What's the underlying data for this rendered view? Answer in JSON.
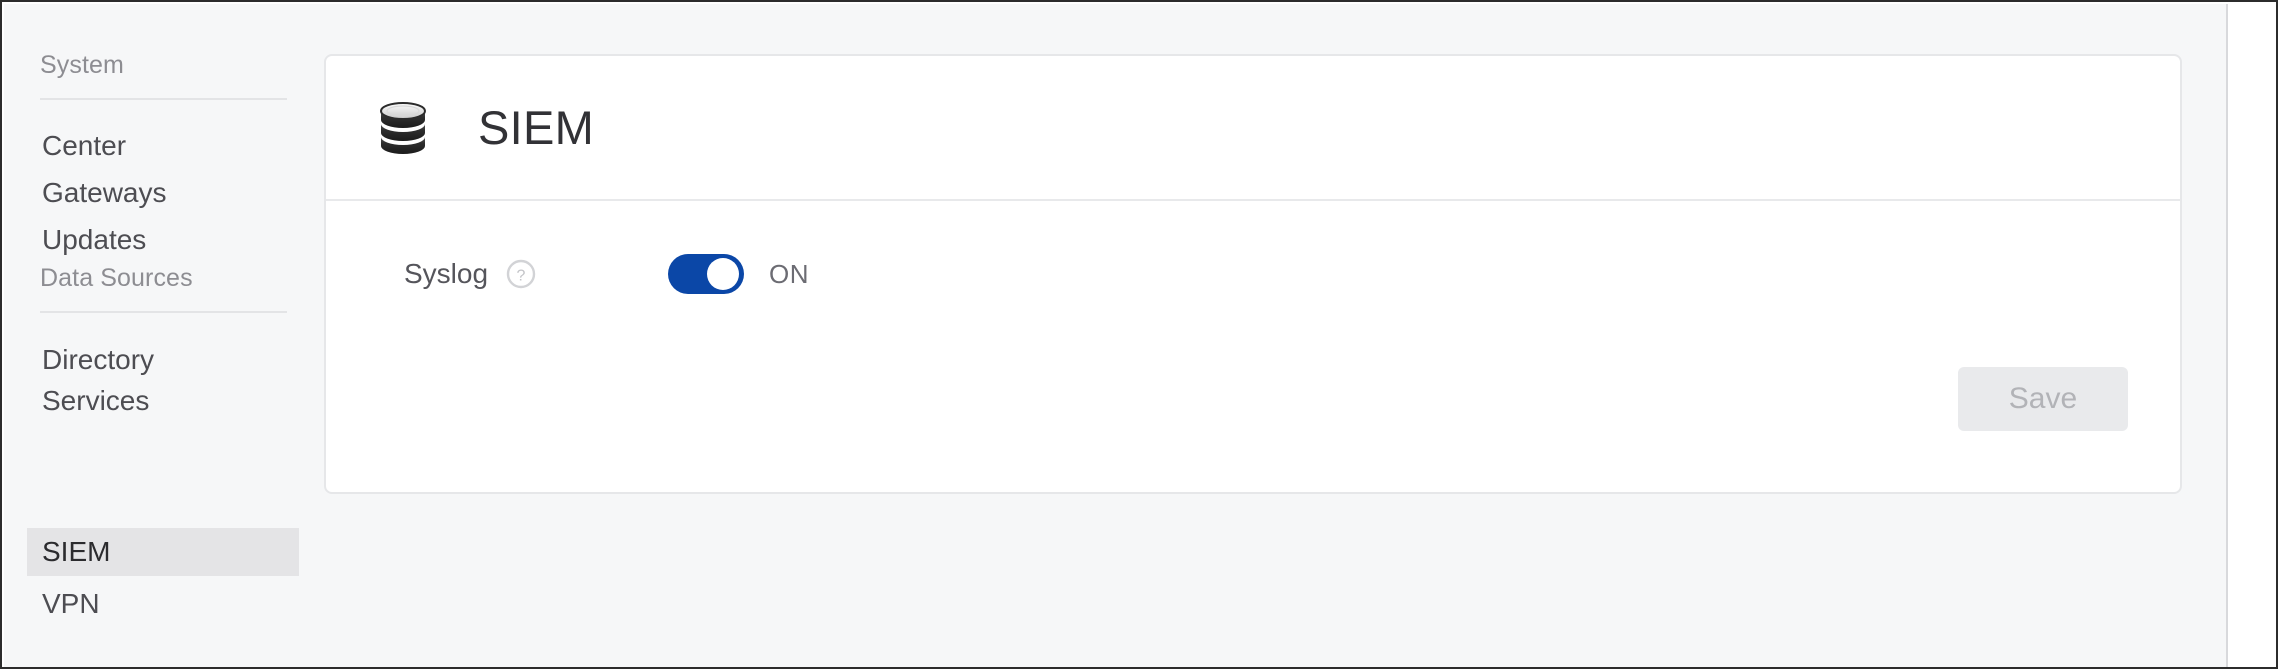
{
  "sidebar": {
    "sections": [
      {
        "title": "System",
        "items": [
          {
            "label": "Center",
            "active": false
          },
          {
            "label": "Gateways",
            "active": false
          },
          {
            "label": "Updates",
            "active": false
          }
        ]
      },
      {
        "title": "Data Sources",
        "items": [
          {
            "label": "Directory Services",
            "active": false
          },
          {
            "label": "SIEM",
            "active": true
          },
          {
            "label": "VPN",
            "active": false
          }
        ]
      }
    ]
  },
  "card": {
    "icon": "database-icon",
    "title": "SIEM",
    "settings": [
      {
        "label": "Syslog",
        "help_icon": "help-circle-icon",
        "toggle_on": true,
        "state_label": "ON"
      }
    ],
    "save_label": "Save",
    "save_disabled": true
  },
  "colors": {
    "accent": "#0b47a7",
    "page_background": "#f6f7f8",
    "card_background": "#ffffff",
    "active_nav_background": "#e4e4e6",
    "disabled_button_background": "#e9eaec",
    "disabled_button_text": "#b2b3b7"
  }
}
